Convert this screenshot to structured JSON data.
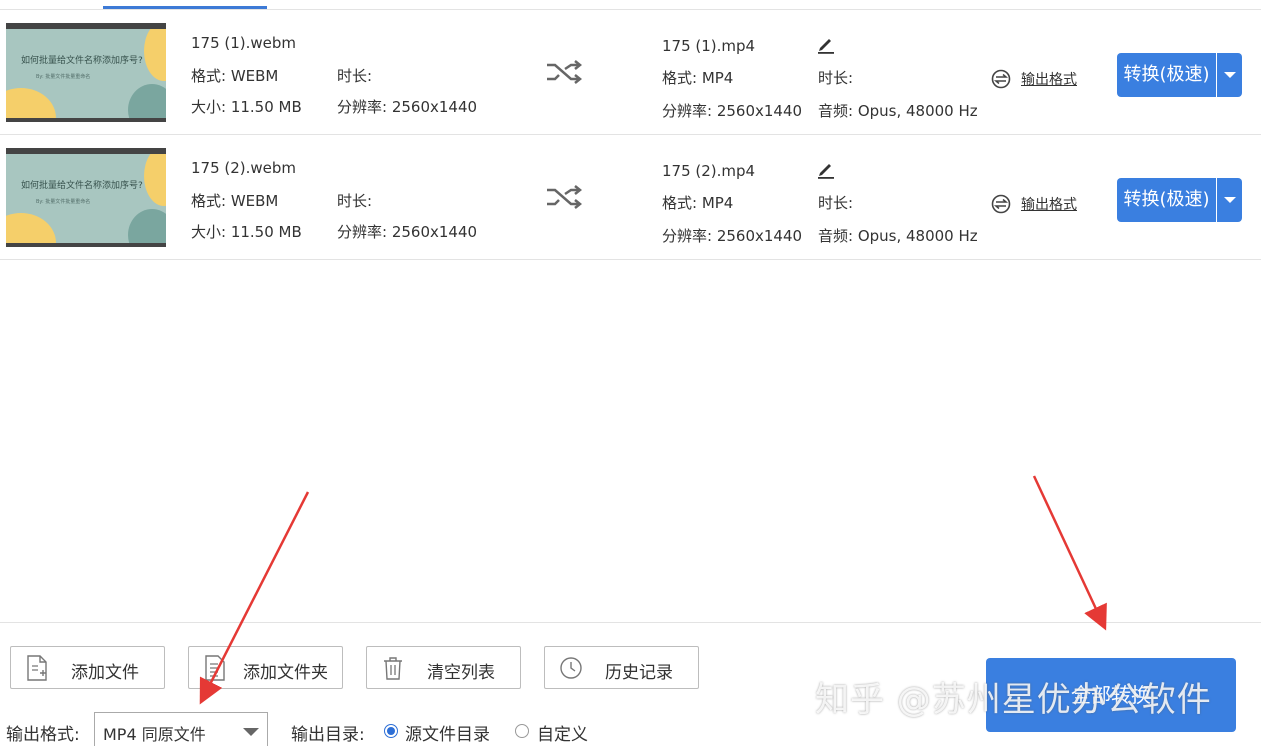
{
  "files": [
    {
      "thumb_title": "如何批量给文件名称添加序号?",
      "thumb_sub": "By: 批量文件批量重命名",
      "src_name": "175 (1).webm",
      "src_format": "格式: WEBM",
      "src_size": "大小: 11.50 MB",
      "src_duration": "时长:",
      "src_resolution": "分辨率: 2560x1440",
      "out_name": "175 (1).mp4",
      "out_format": "格式: MP4",
      "out_resolution": "分辨率: 2560x1440",
      "out_duration": "时长:",
      "out_audio": "音频: Opus, 48000 Hz",
      "format_link": "输出格式",
      "convert_label": "转换(极速)"
    },
    {
      "thumb_title": "如何批量给文件名称添加序号?",
      "thumb_sub": "By: 批量文件批量重命名",
      "src_name": "175 (2).webm",
      "src_format": "格式: WEBM",
      "src_size": "大小: 11.50 MB",
      "src_duration": "时长:",
      "src_resolution": "分辨率: 2560x1440",
      "out_name": "175 (2).mp4",
      "out_format": "格式: MP4",
      "out_resolution": "分辨率: 2560x1440",
      "out_duration": "时长:",
      "out_audio": "音频: Opus, 48000 Hz",
      "format_link": "输出格式",
      "convert_label": "转换(极速)"
    }
  ],
  "toolbar": {
    "add_file": "添加文件",
    "add_folder": "添加文件夹",
    "clear_list": "清空列表",
    "history": "历史记录"
  },
  "output": {
    "format_label": "输出格式:",
    "format_value": "MP4 同原文件",
    "dir_label": "输出目录:",
    "dir_source": "源文件目录",
    "dir_custom": "自定义",
    "dir_selected": "源文件目录"
  },
  "start_button": "全部转换",
  "watermark": "知乎 @苏州星优办公软件",
  "colors": {
    "accent": "#3a7fe0",
    "annotation_arrow": "#e53935"
  }
}
